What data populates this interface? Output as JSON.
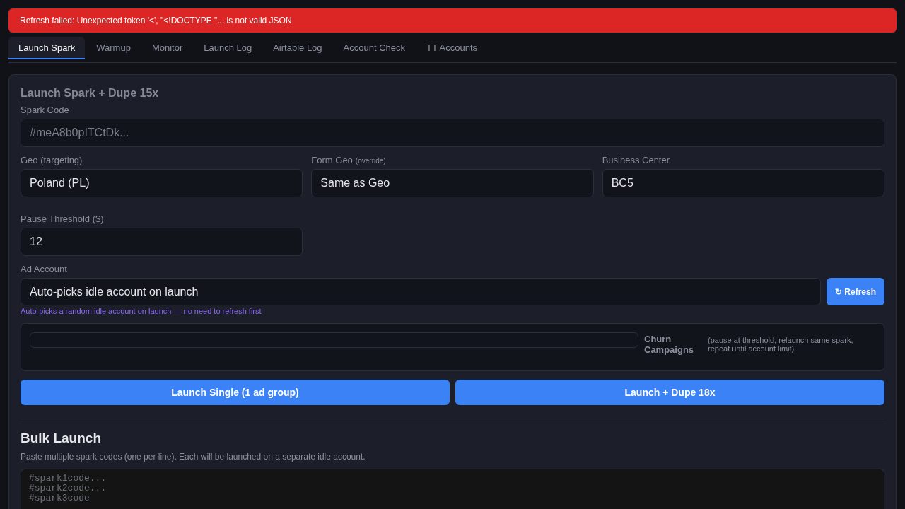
{
  "alert": {
    "message": "Refresh failed: Unexpected token '<', \"<!DOCTYPE \"... is not valid JSON"
  },
  "tabs": [
    {
      "label": "Launch Spark",
      "selected": true
    },
    {
      "label": "Warmup",
      "selected": false
    },
    {
      "label": "Monitor",
      "selected": false
    },
    {
      "label": "Launch Log",
      "selected": false
    },
    {
      "label": "Airtable Log",
      "selected": false
    },
    {
      "label": "Account Check",
      "selected": false
    },
    {
      "label": "TT Accounts",
      "selected": false
    }
  ],
  "launch_panel": {
    "title": "Launch Spark + Dupe 15x",
    "spark_code": {
      "label": "Spark Code",
      "placeholder": "#meA8b0pITCtDk..."
    },
    "targeting": [
      {
        "label": "Geo (targeting)",
        "value": "Poland (PL)"
      },
      {
        "label": "Form Geo",
        "note": "(override)",
        "value": "Same as Geo"
      },
      {
        "label": "Business Center",
        "value": "BC5"
      }
    ],
    "pause_threshold": {
      "label": "Pause Threshold ($)",
      "value": "12"
    },
    "ad_account": {
      "label": "Ad Account",
      "value": "Auto-picks idle account on launch",
      "refresh_button": "↻ Refresh",
      "hint": "Auto-picks a random idle account on launch — no need to refresh first"
    },
    "churn": {
      "label": "Churn Campaigns",
      "description": "(pause at threshold, relaunch same spark, repeat until account limit)"
    },
    "buttons": [
      "Launch Single (1 ad group)",
      "Launch + Dupe 18x"
    ]
  },
  "bulk_launch": {
    "title": "Bulk Launch",
    "description": "Paste multiple spark codes (one per line). Each will be launched on a separate idle account.",
    "placeholder": "#spark1code...\n#spark2code...\n#spark3code"
  }
}
